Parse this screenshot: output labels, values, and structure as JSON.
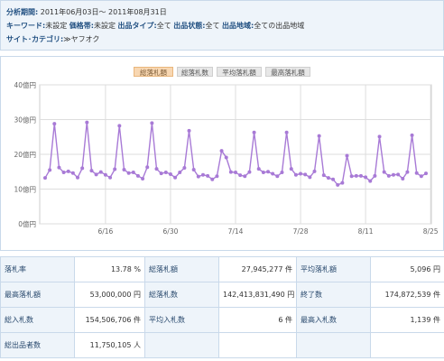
{
  "info": {
    "period_label": "分析期間:",
    "period_value": "2011年06月03日～ 2011年08月31日",
    "keyword_label": "キーワード:",
    "keyword_value": "未設定",
    "price_label": "価格帯:",
    "price_value": "未設定",
    "type_label": "出品タイプ:",
    "type_value": "全て",
    "condition_label": "出品状態:",
    "condition_value": "全て",
    "region_label": "出品地域:",
    "region_value": "全ての出品地域",
    "site_label": "サイト･カテゴリ:",
    "site_value": "≫ヤフオク"
  },
  "tabs": [
    "総落札額",
    "総落札数",
    "平均落札額",
    "最高落札額"
  ],
  "active_tab": 0,
  "colors": {
    "line": "#a87ad6",
    "marker": "#a87ad6",
    "grid": "#dddddd",
    "active_tab": "#f8d7b2"
  },
  "chart_data": {
    "type": "line",
    "ylabels": [
      "0億円",
      "10億円",
      "20億円",
      "30億円",
      "40億円"
    ],
    "ylim": [
      0,
      40
    ],
    "xticks": [
      "6/16",
      "6/30",
      "7/14",
      "7/28",
      "8/11",
      "8/25"
    ],
    "xtick_day_index": [
      13,
      27,
      41,
      55,
      69,
      83
    ],
    "x_start": "2011-06-03",
    "x_end": "2011-08-31",
    "grid": true,
    "series": [
      {
        "values": [
          13.2,
          15.5,
          28.8,
          16.2,
          14.8,
          15.1,
          14.6,
          13.3,
          16.0,
          29.2,
          15.3,
          14.2,
          14.9,
          14.1,
          13.3,
          15.7,
          28.2,
          15.6,
          14.6,
          14.8,
          13.8,
          13.0,
          16.3,
          29.0,
          15.8,
          14.5,
          14.8,
          14.3,
          13.3,
          14.8,
          16.1,
          26.8,
          15.6,
          13.6,
          14.1,
          13.8,
          12.8,
          13.7,
          21.0,
          19.1,
          14.9,
          14.8,
          14.0,
          13.7,
          14.9,
          26.3,
          15.8,
          14.8,
          15.0,
          14.4,
          13.7,
          14.8,
          26.3,
          15.8,
          14.1,
          14.4,
          14.2,
          13.4,
          15.1,
          25.3,
          14.0,
          13.2,
          12.8,
          11.2,
          11.8,
          19.6,
          13.7,
          13.8,
          13.8,
          13.4,
          12.3,
          13.8,
          25.1,
          14.9,
          13.8,
          14.1,
          14.2,
          13.0,
          14.9,
          25.5,
          14.6,
          13.7,
          14.5
        ]
      }
    ]
  },
  "stats": [
    [
      {
        "label": "落札率",
        "value": "13.78 %"
      },
      {
        "label": "総落札額",
        "value": "27,945,277 件"
      },
      {
        "label": "平均落札額",
        "value": "5,096 円"
      }
    ],
    [
      {
        "label": "最高落札額",
        "value": "53,000,000 円"
      },
      {
        "label": "総落札数",
        "value": "142,413,831,490 円"
      },
      {
        "label": "終了数",
        "value": "174,872,539 件"
      }
    ],
    [
      {
        "label": "総入札数",
        "value": "154,506,706 件"
      },
      {
        "label": "平均入札数",
        "value": "6 件"
      },
      {
        "label": "最高入札数",
        "value": "1,139 件"
      }
    ],
    [
      {
        "label": "総出品者数",
        "value": "11,750,105 人"
      }
    ]
  ]
}
